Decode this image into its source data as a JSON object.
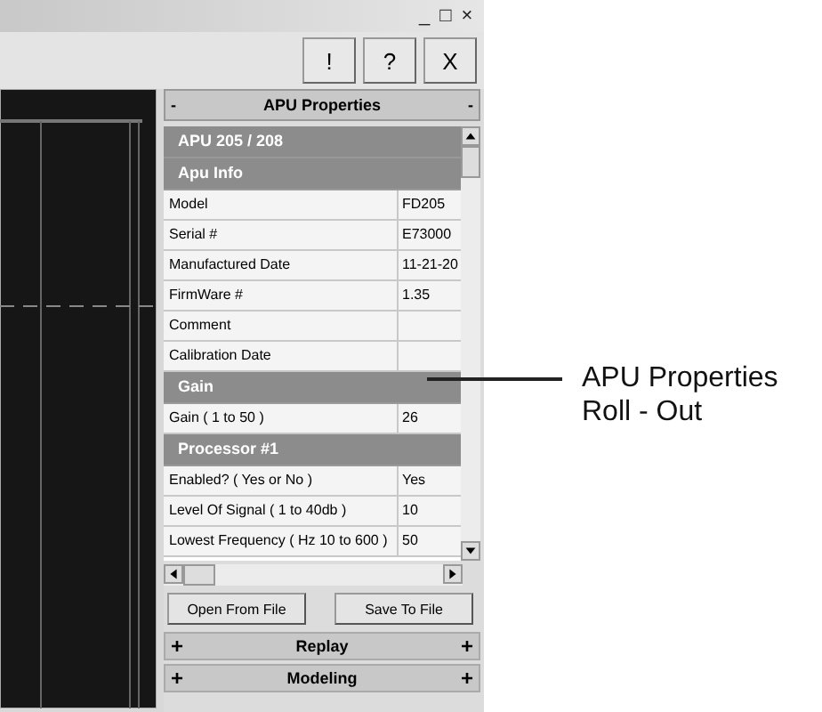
{
  "window": {
    "controls": [
      "_",
      "□",
      "×"
    ]
  },
  "toolbar": {
    "buttons": [
      "!",
      "?",
      "X"
    ]
  },
  "panel": {
    "title": "APU Properties",
    "sign_left": "-",
    "sign_right": "-",
    "rows": [
      {
        "kind": "title",
        "label": "APU 205 / 208"
      },
      {
        "kind": "group",
        "label": "Apu Info"
      },
      {
        "kind": "property",
        "label": "Model",
        "value": "FD205"
      },
      {
        "kind": "property",
        "label": "Serial #",
        "value": "E73000"
      },
      {
        "kind": "property",
        "label": "Manufactured Date",
        "value": "11-21-20"
      },
      {
        "kind": "property",
        "label": "FirmWare #",
        "value": "1.35"
      },
      {
        "kind": "property",
        "label": "Comment"
      },
      {
        "kind": "property",
        "label": "Calibration Date"
      },
      {
        "kind": "group",
        "label": "Gain"
      },
      {
        "kind": "property",
        "label": "Gain ( 1 to 50 )",
        "value": "26"
      },
      {
        "kind": "group",
        "label": "Processor #1"
      },
      {
        "kind": "property",
        "label": "Enabled? ( Yes or No )",
        "value": "Yes"
      },
      {
        "kind": "property",
        "label": "Level Of Signal ( 1 to 40db )",
        "value": "10"
      },
      {
        "kind": "property",
        "label": "Lowest Frequency ( Hz 10 to 600 )",
        "value": "50"
      }
    ],
    "buttons": [
      "Open From File",
      "Save To File"
    ],
    "sections": [
      {
        "title": "Replay",
        "sign_left": "+",
        "sign_right": "+"
      },
      {
        "title": "Modeling",
        "sign_left": "+",
        "sign_right": "+"
      }
    ]
  },
  "annotation": {
    "lines": [
      "APU Properties",
      "Roll - Out"
    ]
  }
}
